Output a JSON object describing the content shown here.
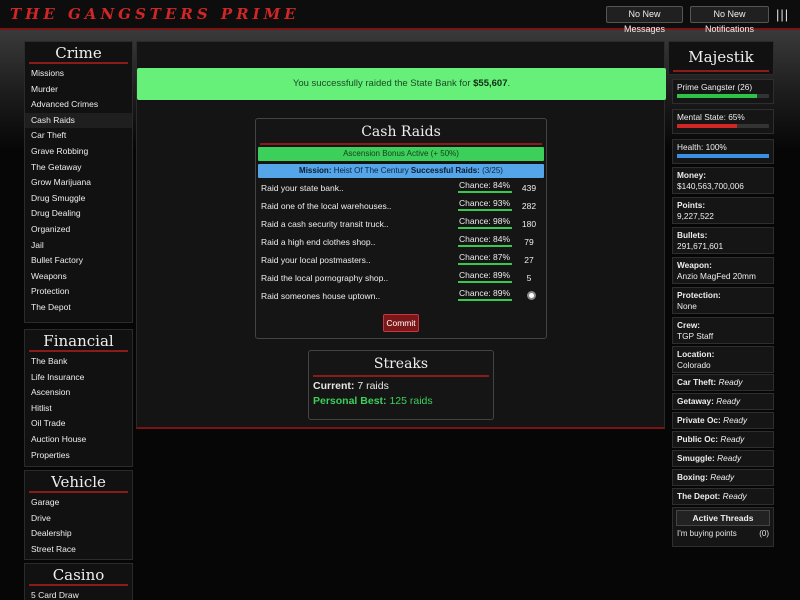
{
  "header": {
    "logo": "THE GANGSTERS PRIME",
    "messages": "No New Messages",
    "notifications": "No New Notifications",
    "menu_icon": "|||"
  },
  "sidebar": {
    "crime": {
      "title": "Crime",
      "items": [
        "Missions",
        "Murder",
        "Advanced Crimes",
        "Cash Raids",
        "Car Theft",
        "Grave Robbing",
        "The Getaway",
        "Grow Marijuana",
        "Drug Smuggle",
        "Drug Dealing",
        "Organized",
        "Jail",
        "Bullet Factory",
        "Weapons",
        "Protection",
        "The Depot"
      ]
    },
    "financial": {
      "title": "Financial",
      "items": [
        "The Bank",
        "Life Insurance",
        "Ascension",
        "Hitlist",
        "Oil Trade",
        "Auction House",
        "Properties"
      ]
    },
    "vehicle": {
      "title": "Vehicle",
      "items": [
        "Garage",
        "Drive",
        "Dealership",
        "Street Race"
      ]
    },
    "casino": {
      "title": "Casino",
      "items": [
        "5 Card Draw"
      ]
    }
  },
  "main": {
    "success_prefix": "You successfully raided the State Bank for ",
    "success_amount": "$55,607",
    "success_suffix": ".",
    "raids_title": "Cash Raids",
    "bonus": "Ascension Bonus Active (+ 50%)",
    "mission_label": "Mission:",
    "mission_name": " Heist Of The Century ",
    "successful_label": "Successful Raids:",
    "successful_value": " (3/25)",
    "rows": [
      {
        "label": "Raid your state bank..",
        "chance": "Chance: 84%",
        "count": "439"
      },
      {
        "label": "Raid one of the local warehouses..",
        "chance": "Chance: 93%",
        "count": "282"
      },
      {
        "label": "Raid a cash security transit truck..",
        "chance": "Chance: 98%",
        "count": "180"
      },
      {
        "label": "Raid a high end clothes shop..",
        "chance": "Chance: 84%",
        "count": "79"
      },
      {
        "label": "Raid your local postmasters..",
        "chance": "Chance: 87%",
        "count": "27"
      },
      {
        "label": "Raid the local pornography shop..",
        "chance": "Chance: 89%",
        "count": "5"
      },
      {
        "label": "Raid someones house uptown..",
        "chance": "Chance: 89%",
        "count": ""
      }
    ],
    "commit": "Commit",
    "streaks_title": "Streaks",
    "current_label": "Current:",
    "current_value": " 7 raids",
    "best_label": "Personal Best:",
    "best_value": " 125 raids"
  },
  "profile": {
    "name": "Majestik",
    "rank": "Prime Gangster (26)",
    "rank_progress": 0.87,
    "mental": "Mental State: 65%",
    "mental_progress": 0.65,
    "health": "Health: 100%",
    "health_progress": 1.0,
    "colors": {
      "rank": "#2ec24a",
      "mental": "#d02626",
      "health": "#3a8fe0"
    },
    "money_label": "Money:",
    "money": "$140,563,700,006",
    "points_label": "Points:",
    "points": "9,227,522",
    "bullets_label": "Bullets:",
    "bullets": "291,671,601",
    "weapon_label": "Weapon:",
    "weapon": "Anzio MagFed 20mm",
    "protection_label": "Protection:",
    "protection": "None",
    "crew_label": "Crew:",
    "crew": "TGP Staff",
    "location_label": "Location:",
    "location": "Colorado",
    "timers": [
      {
        "label": "Car Theft:",
        "value": "Ready"
      },
      {
        "label": "Getaway:",
        "value": "Ready"
      },
      {
        "label": "Private Oc:",
        "value": "Ready"
      },
      {
        "label": "Public Oc:",
        "value": "Ready"
      },
      {
        "label": "Smuggle:",
        "value": "Ready"
      },
      {
        "label": "Boxing:",
        "value": "Ready"
      },
      {
        "label": "The Depot:",
        "value": "Ready"
      }
    ],
    "threads_button": "Active Threads",
    "thread_title": "I'm buying points",
    "thread_count": "(0)"
  }
}
